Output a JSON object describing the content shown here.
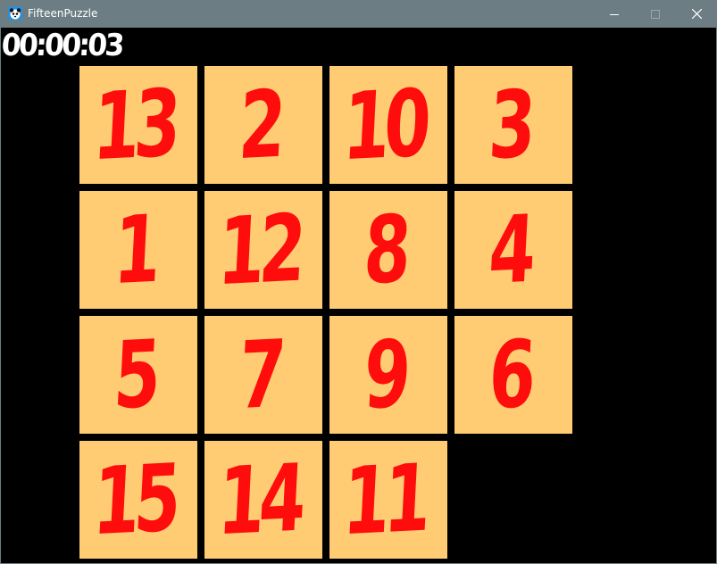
{
  "window": {
    "title": "FifteenPuzzle",
    "icon": "panda-app-icon",
    "controls": [
      "minimize-icon",
      "maximize-icon",
      "close-icon"
    ]
  },
  "game": {
    "timer": "00:00:03",
    "rows": 4,
    "cols": 4,
    "tiles": [
      [
        "13",
        "2",
        "10",
        "3"
      ],
      [
        "1",
        "12",
        "8",
        "4"
      ],
      [
        "5",
        "7",
        "9",
        "6"
      ],
      [
        "15",
        "14",
        "11",
        ""
      ]
    ],
    "colors": {
      "background": "#000000",
      "tile": "#ffcc73",
      "number": "#ff0d0d",
      "timer": "#ffffff",
      "titlebar": "#6c7d84"
    }
  }
}
